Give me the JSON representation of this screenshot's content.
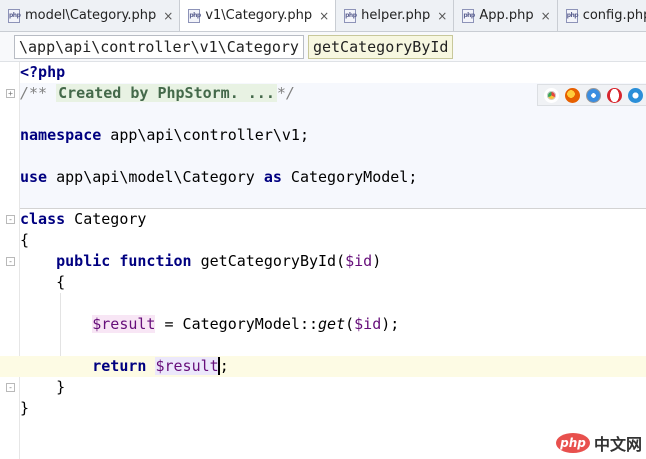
{
  "tabs": [
    {
      "label": "model\\Category.php",
      "icon": "php-file-icon",
      "active": false
    },
    {
      "label": "v1\\Category.php",
      "icon": "php-file-icon",
      "active": true
    },
    {
      "label": "helper.php",
      "icon": "php-file-icon",
      "active": false
    },
    {
      "label": "App.php",
      "icon": "php-file-icon",
      "active": false
    },
    {
      "label": "config.php",
      "icon": "php-file-icon",
      "active": false
    }
  ],
  "icons": {
    "php_badge": "php",
    "close": "×"
  },
  "breadcrumb": {
    "class_path": "\\app\\api\\controller\\v1\\Category",
    "method": "getCategoryById"
  },
  "code": {
    "php_open": "<?php",
    "comment_start": "/** ",
    "comment_fold": "Created by PhpStorm. ...",
    "comment_end": "*/",
    "namespace_kw": "namespace",
    "namespace_path": " app\\api\\controller\\v1;",
    "use_kw": "use",
    "use_path": " app\\api\\model\\Category ",
    "as_kw": "as",
    "use_alias": " CategoryModel;",
    "class_kw": "class",
    "class_name": " Category",
    "brace_open": "{",
    "public_kw": "public",
    "function_kw": "function",
    "func_sig_name": " getCategoryById(",
    "func_sig_param": "$id",
    "func_sig_close": ")",
    "inner_brace_open": "{",
    "result_var": "$result",
    "assign_mid": " = CategoryModel::",
    "get_fn": "get",
    "get_args_open": "(",
    "get_arg": "$id",
    "get_args_close": ");",
    "return_kw": "return",
    "return_var": "$result",
    "return_semicolon": ";",
    "inner_brace_close": "}",
    "brace_close": "}"
  },
  "browser_icons": [
    "chrome-icon",
    "firefox-icon",
    "safari-icon",
    "opera-icon",
    "ie-icon"
  ],
  "colors": {
    "chrome": "#e8453c",
    "firefox": "#e66000",
    "safari": "#3b8de0",
    "opera": "#d7262e",
    "ie": "#2b8fd8"
  },
  "watermark": {
    "badge": "php",
    "text": "中文网"
  }
}
